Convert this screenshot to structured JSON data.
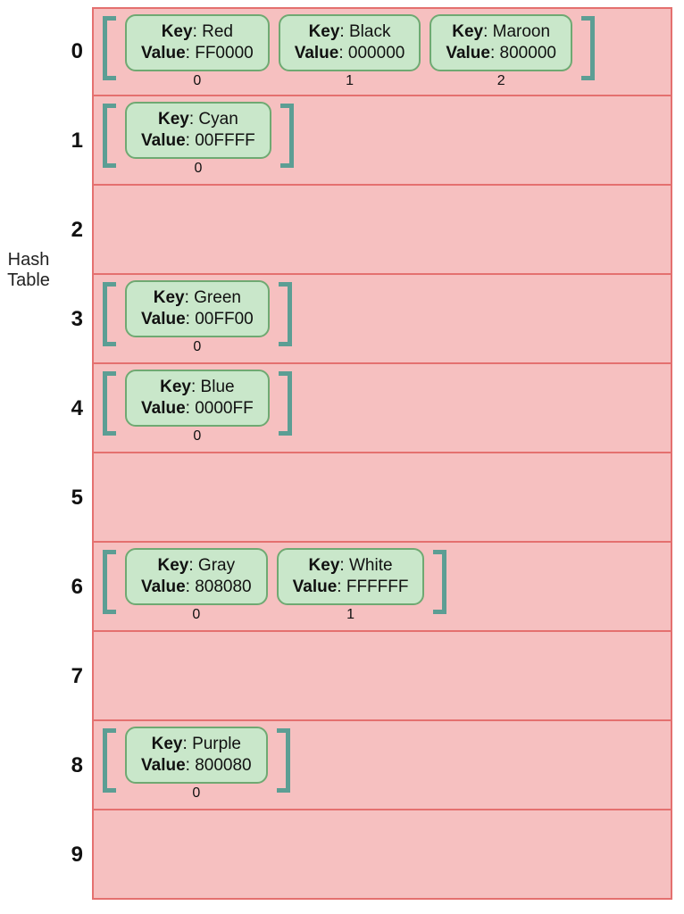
{
  "labels": {
    "side": "Hash\nTable",
    "key": "Key",
    "value": "Value"
  },
  "buckets": [
    {
      "index": "0",
      "items": [
        {
          "key": "Red",
          "value": "FF0000",
          "pos": "0"
        },
        {
          "key": "Black",
          "value": "000000",
          "pos": "1"
        },
        {
          "key": "Maroon",
          "value": "800000",
          "pos": "2"
        }
      ]
    },
    {
      "index": "1",
      "items": [
        {
          "key": "Cyan",
          "value": "00FFFF",
          "pos": "0"
        }
      ]
    },
    {
      "index": "2",
      "items": []
    },
    {
      "index": "3",
      "items": [
        {
          "key": "Green",
          "value": "00FF00",
          "pos": "0"
        }
      ]
    },
    {
      "index": "4",
      "items": [
        {
          "key": "Blue",
          "value": "0000FF",
          "pos": "0"
        }
      ]
    },
    {
      "index": "5",
      "items": []
    },
    {
      "index": "6",
      "items": [
        {
          "key": "Gray",
          "value": "808080",
          "pos": "0"
        },
        {
          "key": "White",
          "value": "FFFFFF",
          "pos": "1"
        }
      ]
    },
    {
      "index": "7",
      "items": []
    },
    {
      "index": "8",
      "items": [
        {
          "key": "Purple",
          "value": "800080",
          "pos": "0"
        }
      ]
    },
    {
      "index": "9",
      "items": []
    }
  ]
}
